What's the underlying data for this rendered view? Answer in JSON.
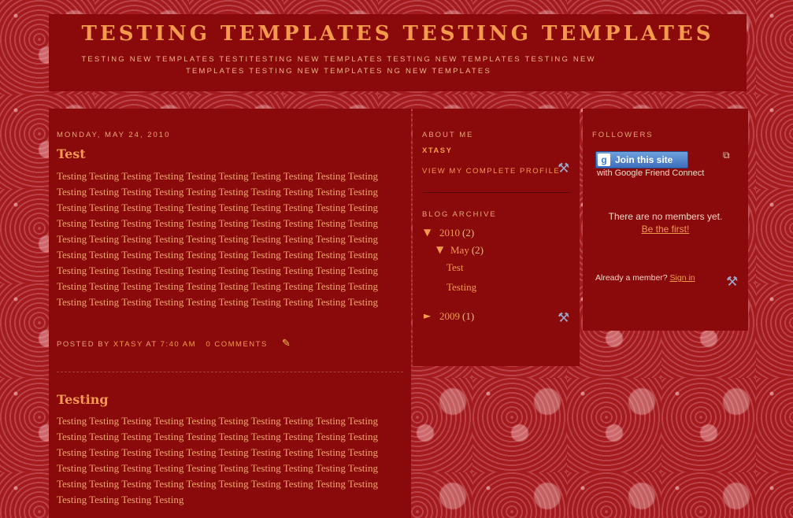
{
  "header": {
    "title": "TESTING TEMPLATES TESTING TEMPLATES",
    "description": "TESTING NEW TEMPLATES TESTITESTING NEW TEMPLATES TESTING NEW TEMPLATES TESTING NEW TEMPLATES TESTING NEW TEMPLATES NG NEW TEMPLATES"
  },
  "posts": [
    {
      "date": "MONDAY, MAY 24, 2010",
      "title": "Test",
      "body": "Testing Testing Testing Testing Testing Testing Testing Testing Testing Testing Testing Testing Testing Testing Testing Testing Testing Testing Testing Testing Testing Testing Testing Testing Testing Testing Testing Testing Testing Testing Testing Testing Testing Testing Testing Testing Testing Testing Testing Testing Testing Testing Testing Testing Testing Testing Testing Testing Testing Testing Testing Testing Testing Testing Testing Testing Testing Testing Testing Testing Testing Testing Testing Testing Testing Testing Testing Testing Testing Testing Testing Testing Testing Testing Testing Testing Testing Testing Testing Testing Testing Testing Testing Testing Testing Testing Testing Testing Testing Testing",
      "posted_by_label": "POSTED BY",
      "author": "XTASY",
      "at_label": "AT",
      "time": "7:40 AM",
      "comments": "0 COMMENTS"
    },
    {
      "title": "Testing",
      "body": "Testing Testing Testing Testing Testing Testing Testing Testing Testing Testing Testing Testing Testing Testing Testing Testing Testing Testing Testing Testing Testing Testing Testing Testing Testing Testing Testing Testing Testing Testing Testing Testing Testing Testing Testing Testing Testing Testing Testing Testing Testing Testing Testing Testing Testing Testing Testing Testing Testing Testing Testing Testing Testing Testing"
    }
  ],
  "about": {
    "heading": "ABOUT ME",
    "name": "XTASY",
    "profile_link": "VIEW MY COMPLETE PROFILE"
  },
  "archive": {
    "heading": "BLOG ARCHIVE",
    "expanded_glyph": "▼",
    "collapsed_glyph": "►",
    "years": [
      {
        "year": "2010",
        "count": "(2)",
        "months": [
          {
            "month": "May",
            "count": "(2)",
            "posts": [
              "Test",
              "Testing"
            ]
          }
        ]
      },
      {
        "year": "2009",
        "count": "(1)"
      }
    ]
  },
  "followers": {
    "heading": "FOLLOWERS",
    "join_button": "Join this site",
    "join_sub": "with Google Friend Connect",
    "no_members": "There are no members yet.",
    "be_first": "Be the first!",
    "already_member": "Already a member?",
    "sign_in": "Sign in"
  },
  "icons": {
    "tool": "tools-icon",
    "pencil": "edit-pencil-icon",
    "popout": "popout-icon"
  },
  "colors": {
    "background": "#a31a1f",
    "panel": "#8a0a0c",
    "accent": "#f39a4d"
  }
}
